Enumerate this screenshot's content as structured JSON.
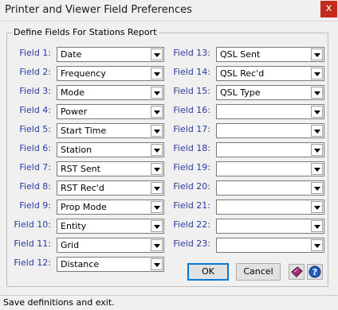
{
  "window": {
    "title": "Printer and Viewer Field Preferences",
    "close_glyph": "x"
  },
  "group": {
    "title": "Define Fields For Stations Report"
  },
  "fields_left": [
    {
      "label": "Field 1:",
      "value": "Date"
    },
    {
      "label": "Field 2:",
      "value": "Frequency"
    },
    {
      "label": "Field 3:",
      "value": "Mode"
    },
    {
      "label": "Field 4:",
      "value": "Power"
    },
    {
      "label": "Field 5:",
      "value": "Start Time"
    },
    {
      "label": "Field 6:",
      "value": "Station"
    },
    {
      "label": "Field 7:",
      "value": "RST Sent"
    },
    {
      "label": "Field 8:",
      "value": "RST Rec'd"
    },
    {
      "label": "Field 9:",
      "value": "Prop Mode"
    },
    {
      "label": "Field 10:",
      "value": "Entity"
    },
    {
      "label": "Field 11:",
      "value": "Grid"
    },
    {
      "label": "Field 12:",
      "value": "Distance"
    }
  ],
  "fields_right": [
    {
      "label": "Field 13:",
      "value": "QSL Sent"
    },
    {
      "label": "Field 14:",
      "value": "QSL Rec'd"
    },
    {
      "label": "Field 15:",
      "value": "QSL Type"
    },
    {
      "label": "Field 16:",
      "value": ""
    },
    {
      "label": "Field 17:",
      "value": ""
    },
    {
      "label": "Field 18:",
      "value": ""
    },
    {
      "label": "Field 19:",
      "value": ""
    },
    {
      "label": "Field 20:",
      "value": ""
    },
    {
      "label": "Field 21:",
      "value": ""
    },
    {
      "label": "Field 22:",
      "value": ""
    },
    {
      "label": "Field 23:",
      "value": ""
    }
  ],
  "buttons": {
    "ok": "OK",
    "cancel": "Cancel"
  },
  "status": "Save definitions and exit.",
  "colors": {
    "label": "#2b3aa6",
    "close": "#c42b1c",
    "default_border": "#0078d7"
  }
}
